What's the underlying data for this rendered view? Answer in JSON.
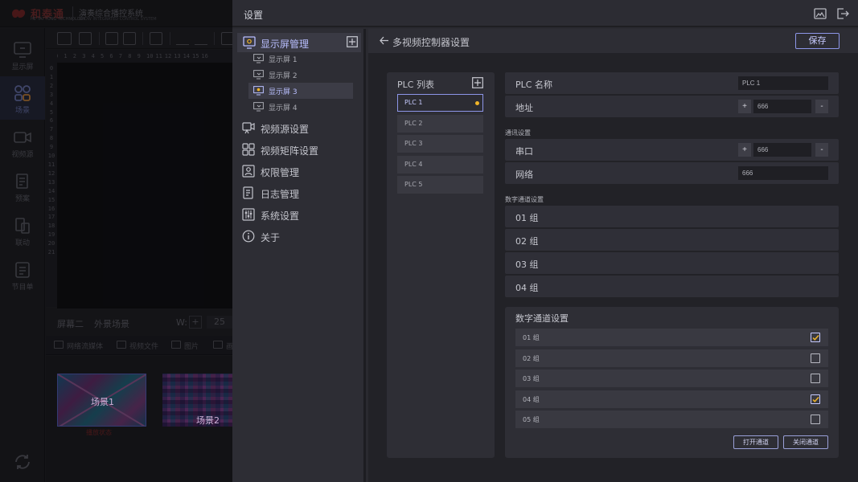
{
  "background_app": {
    "logo_text": "和泰通",
    "logo_sub": "HE TAI TONG TECHNOLOGY",
    "system_name": "演奏综合播控系统",
    "system_sub": "SHOW INTEGRATED CONTROL SYSTEM",
    "nav": [
      {
        "label": "显示屏",
        "icon": "monitor-icon"
      },
      {
        "label": "场景",
        "icon": "scene-grid-icon"
      },
      {
        "label": "视频源",
        "icon": "video-camera-icon"
      },
      {
        "label": "预案",
        "icon": "plan-document-icon"
      },
      {
        "label": "联动",
        "icon": "linkage-icon"
      },
      {
        "label": "节目单",
        "icon": "program-list-icon"
      }
    ],
    "ruler_h": [
      "0",
      "1",
      "2",
      "3",
      "4",
      "5",
      "6",
      "7",
      "8",
      "9",
      "10",
      "11",
      "12",
      "13",
      "14",
      "15",
      "16"
    ],
    "ruler_v": "0 1 2 3 4 5 6 7 8 9 10 11 12 13 14 15 16 17 18 19 20 21",
    "status": {
      "screen": "屏幕二",
      "scene": "外景场景",
      "w_label": "W:",
      "plus": "+",
      "value": "25"
    },
    "media_tabs": [
      "网络流媒体",
      "视频文件",
      "图片",
      "画"
    ],
    "scenes": [
      {
        "label": "场景1",
        "status": "播放状态"
      },
      {
        "label": "场景2"
      }
    ]
  },
  "settings": {
    "title": "设置",
    "sidebar": {
      "display_mgmt": "显示屏管理",
      "screens": [
        "显示屏 1",
        "显示屏 2",
        "显示屏 3",
        "显示屏 4"
      ],
      "active_screen_index": 2,
      "menu": [
        {
          "label": "视频源设置",
          "icon": "video-source-icon"
        },
        {
          "label": "视频矩阵设置",
          "icon": "matrix-grid-icon"
        },
        {
          "label": "权限管理",
          "icon": "permission-user-icon"
        },
        {
          "label": "日志管理",
          "icon": "log-document-icon"
        },
        {
          "label": "系统设置",
          "icon": "sliders-icon"
        },
        {
          "label": "关于",
          "icon": "info-icon"
        }
      ]
    },
    "content": {
      "breadcrumb": "多视频控制器设置",
      "save": "保存",
      "plc_list": {
        "title": "PLC 列表",
        "items": [
          "PLC 1",
          "PLC 2",
          "PLC 3",
          "PLC 4",
          "PLC 5"
        ],
        "active_index": 0
      },
      "form": {
        "plc_name_label": "PLC 名称",
        "plc_name_value": "PLC 1",
        "address_label": "地址",
        "address_value": "666",
        "comm_section": "通讯设置",
        "serial_label": "串口",
        "serial_value": "666",
        "network_label": "网络",
        "network_value": "666",
        "digital_section": "数字通道设置",
        "groups": [
          "01 组",
          "02 组",
          "03 组",
          "04 组"
        ]
      },
      "digital_panel": {
        "title": "数字通道设置",
        "channels": [
          {
            "label": "01 组",
            "checked": true
          },
          {
            "label": "02 组",
            "checked": false
          },
          {
            "label": "03 组",
            "checked": false
          },
          {
            "label": "04 组",
            "checked": true
          },
          {
            "label": "05 组",
            "checked": false
          }
        ],
        "open_button": "打开通道",
        "close_button": "关闭通道"
      },
      "stepper_plus": "+",
      "stepper_minus": "-"
    }
  },
  "colors": {
    "accent": "#8d96e8",
    "active_text": "#b9bfff",
    "status_dot": "#f0b429"
  }
}
